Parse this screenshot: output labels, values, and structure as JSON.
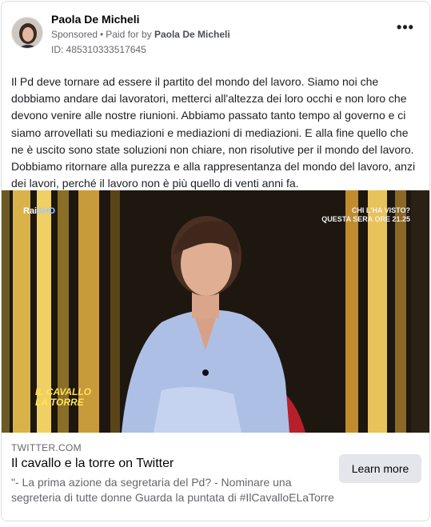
{
  "post": {
    "author": "Paola De Micheli",
    "sponsored_label": "Sponsored",
    "separator": "•",
    "paid_for_prefix": "Paid for by",
    "payer": "Paola De Micheli",
    "ad_id": "ID: 485310333517645",
    "more_label": "•••",
    "text": "Il Pd deve tornare ad essere il partito del mondo del lavoro. Siamo noi che dobbiamo andare dai lavoratori, metterci all'altezza dei loro occhi e non loro che devono venire alle nostre riunioni. Abbiamo passato tanto tempo al governo e ci siamo arrovellati su mediazioni e mediazioni di mediazioni. E alla fine quello che ne è uscito sono state soluzioni non chiare, non risolutive per il mondo del lavoro. Dobbiamo ritornare alla purezza e alla rappresentanza del mondo del lavoro, anzi dei lavori, perché il lavoro non è più quello di venti anni fa."
  },
  "media": {
    "channel_logo": "Rai",
    "channel_number": "3HD",
    "promo_line1": "CHI L'HA VISTO?",
    "promo_line2": "QUESTA SERA ORE 21.25",
    "show_logo_line1": "IL CAVALLO",
    "show_logo_line2": "LA TORRE"
  },
  "link": {
    "domain": "TWITTER.COM",
    "title": "Il cavallo e la torre on Twitter",
    "desc_line1": "\"- La prima azione da segretaria del Pd? - Nominare una",
    "desc_line2": "segreteria di tutte donne Guarda la puntata di #IlCavalloELaTorre",
    "cta_label": "Learn more"
  },
  "colors": {
    "text": "#1c1e21",
    "secondary": "#65676b",
    "button_bg": "#e4e6eb",
    "border": "#dadde1"
  }
}
